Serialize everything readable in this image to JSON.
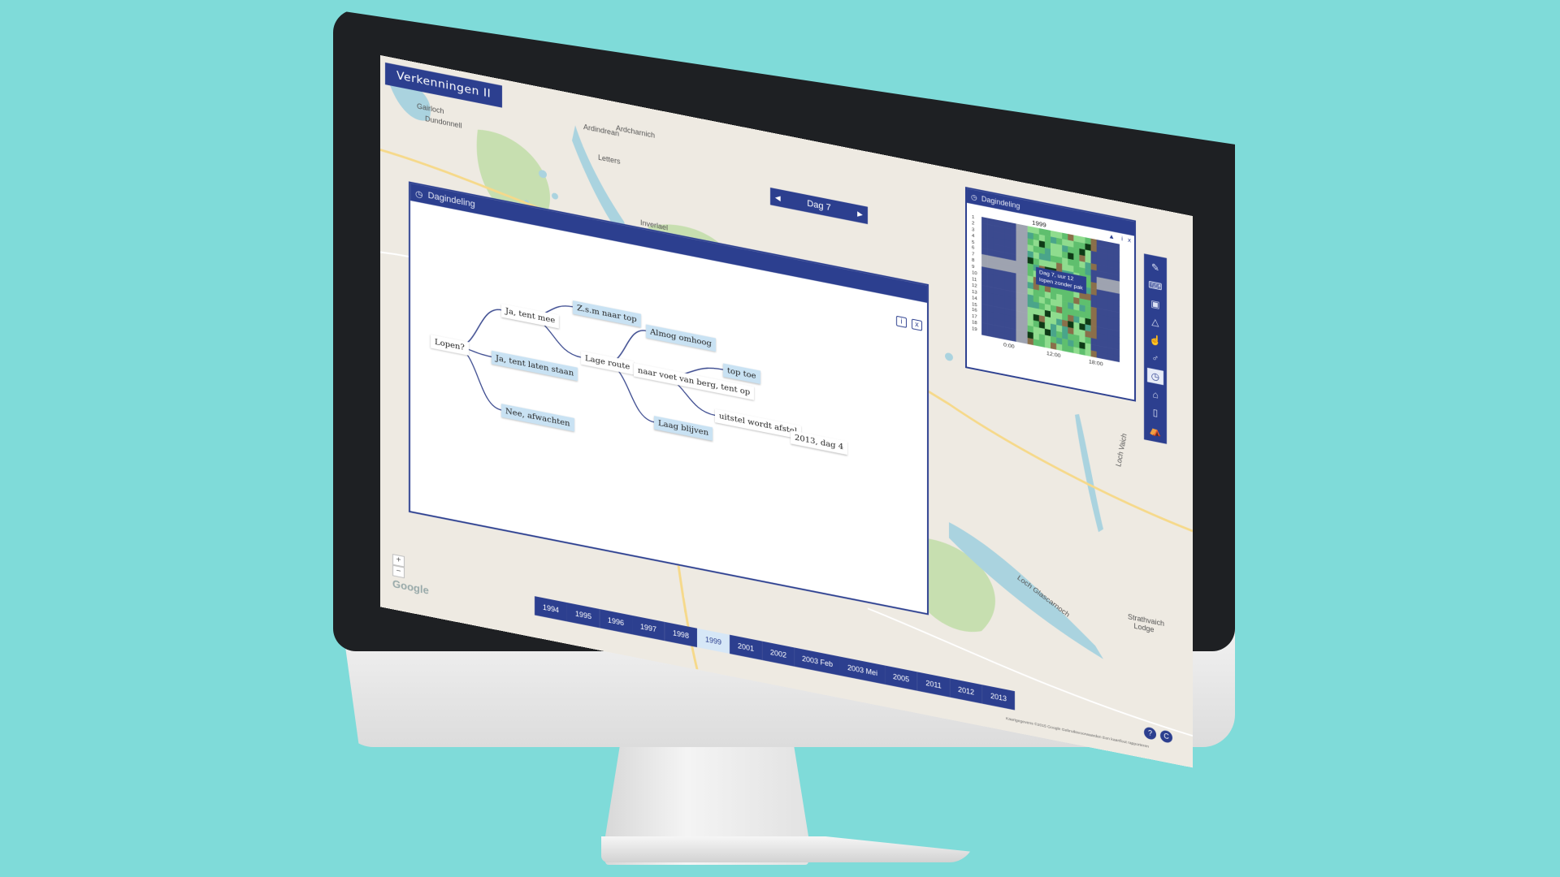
{
  "app": {
    "title": "Verkenningen II"
  },
  "day_nav": {
    "prev": "◀",
    "label": "Dag 7",
    "next": "▶"
  },
  "tree_window": {
    "title": "Dagindeling",
    "info_icon": "i",
    "close_icon": "x",
    "nodes": [
      {
        "id": "root",
        "text": "Lopen?",
        "style": "white"
      },
      {
        "id": "n1",
        "text": "Ja, tent mee",
        "style": "white"
      },
      {
        "id": "n2",
        "text": "Ja, tent laten staan",
        "style": "blue"
      },
      {
        "id": "n3",
        "text": "Nee, afwachten",
        "style": "blue"
      },
      {
        "id": "n4",
        "text": "Z.s.m naar top",
        "style": "blue"
      },
      {
        "id": "n5",
        "text": "Lage route",
        "style": "white"
      },
      {
        "id": "n6",
        "text": "Almog omhoog",
        "style": "blue"
      },
      {
        "id": "n7",
        "text": "naar voet van berg, tent op",
        "style": "white"
      },
      {
        "id": "n8",
        "text": "Laag blijven",
        "style": "blue"
      },
      {
        "id": "n9",
        "text": "top toe",
        "style": "blue"
      },
      {
        "id": "n10",
        "text": "uitstel wordt afstel",
        "style": "white"
      },
      {
        "id": "n11",
        "text": "2013, dag 4",
        "style": "white"
      }
    ],
    "edges": [
      [
        "root",
        "n1"
      ],
      [
        "root",
        "n2"
      ],
      [
        "root",
        "n3"
      ],
      [
        "n1",
        "n4"
      ],
      [
        "n1",
        "n5"
      ],
      [
        "n5",
        "n6"
      ],
      [
        "n5",
        "n7"
      ],
      [
        "n5",
        "n8"
      ],
      [
        "n7",
        "n9"
      ],
      [
        "n7",
        "n10"
      ],
      [
        "n10",
        "n11"
      ]
    ]
  },
  "mini_window": {
    "title": "Dagindeling",
    "year": "1999",
    "warn_icon": "▲",
    "info_icon": "i",
    "close_icon": "x",
    "row_labels": [
      "1",
      "2",
      "3",
      "4",
      "5",
      "6",
      "7",
      "8",
      "9",
      "10",
      "11",
      "12",
      "13",
      "14",
      "15",
      "16",
      "17",
      "18",
      "19"
    ],
    "hour_labels": [
      "0:00",
      "12:00",
      "18:00"
    ],
    "tooltip": [
      "Dag 7, uur 12",
      "lopen zonder pak"
    ],
    "colors": {
      "navy": "#3b4a8f",
      "grey": "#9ea3b0",
      "green": "#5fbf6e",
      "light": "#8fdc8e",
      "teal": "#4aa58a",
      "dark": "#0e3b16",
      "brown": "#8a6f4a"
    }
  },
  "toolbar": {
    "tools": [
      {
        "name": "pencil-icon",
        "glyph": "✎"
      },
      {
        "name": "keyboard-icon",
        "glyph": "⌨"
      },
      {
        "name": "camera-icon",
        "glyph": "▣"
      },
      {
        "name": "mountain-icon",
        "glyph": "△"
      },
      {
        "name": "thumbs-up-icon",
        "glyph": "☝"
      },
      {
        "name": "walker-icon",
        "glyph": "♂"
      },
      {
        "name": "clock-icon",
        "glyph": "◷"
      },
      {
        "name": "shoe-icon",
        "glyph": "⌂"
      },
      {
        "name": "bottle-icon",
        "glyph": "▯"
      },
      {
        "name": "tent-icon",
        "glyph": "⛺"
      }
    ]
  },
  "map_labels": [
    {
      "text": "Gairloch"
    },
    {
      "text": "Dundonnell"
    },
    {
      "text": "Ardindrean"
    },
    {
      "text": "Ardcharnich"
    },
    {
      "text": "Letters"
    },
    {
      "text": "Inverlael"
    },
    {
      "text": "Loch Vaich"
    },
    {
      "text": "Loch Glascarnoch"
    },
    {
      "text": "Strathvaich Lodge"
    }
  ],
  "timeline": {
    "years": [
      "1994",
      "1995",
      "1996",
      "1997",
      "1998",
      "1999",
      "2001",
      "2002",
      "2003 Feb",
      "2003 Mei",
      "2005",
      "2011",
      "2012",
      "2013"
    ],
    "active": "1999"
  },
  "zoom": {
    "in": "+",
    "out": "−"
  },
  "google_logo": "Google",
  "help": "?",
  "copyright": "C",
  "attribution": "Kaartgegevens ©2015 Google    Gebruiksvoorwaarden    Een kaartfout rapporteren"
}
